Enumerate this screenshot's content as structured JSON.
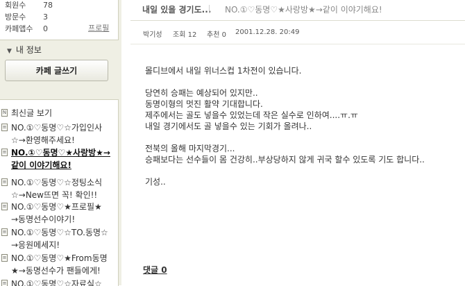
{
  "sidebar": {
    "stats": [
      {
        "label": "회원수",
        "value": "78"
      },
      {
        "label": "방문수",
        "value": "3"
      },
      {
        "label": "카페앱수",
        "value": "0"
      }
    ],
    "profile_link": "프로필",
    "my_info_label": "내 정보",
    "write_button": "카페 글쓰기",
    "menu": [
      {
        "text": "최신글 보기"
      },
      {
        "text": "NO.①♡동명♡☆가입인사\n☆→환영해주세요!"
      },
      {
        "text": "NO.①♡동명♡★사랑방★→\n같이 이야기해요!"
      },
      {
        "text": "NO.①♡동명♡☆정팅소식\n☆→New뜨면 꼭! 확인!!"
      },
      {
        "text": "NO.①♡동명♡★프로필★\n→동명선수이야기!"
      },
      {
        "text": "NO.①♡동명♡☆TO.동명☆\n→응원메세지!"
      },
      {
        "text": "NO.①♡동명♡★From동명\n★→동명선수가 팬들에게!"
      },
      {
        "text": "NO.①♡동명♡☆자료실☆"
      }
    ]
  },
  "post": {
    "title": "내일 있을 경기도...",
    "subtitle": "NO.①♡동명♡★사랑방★→같이 이야기해요!",
    "meta": {
      "author": "박기성",
      "views_label": "조회 12",
      "likes_label": "추천 0",
      "date": "2001.12.28. 20:49"
    },
    "body": [
      "몰디브에서 내일 위너스컵 1차전이 있습니다.",
      "당연히 승패는 예상되어 있지만..\n동명이형의 멋진 활약 기대합니다.\n제주에서는 골도 넣을수 있었는데 작은 실수로 인하여....ㅠ.ㅠ\n내일 경기에서도 골 넣을수 있는 기회가 올려나..",
      "전북의 올해 마지막경기...\n승패보다는 선수들이 몸 건강히..부상당하지 않게 귀국 할수 있도록 기도 합니다..",
      "기성.."
    ],
    "comments_label": "댓글 0"
  }
}
